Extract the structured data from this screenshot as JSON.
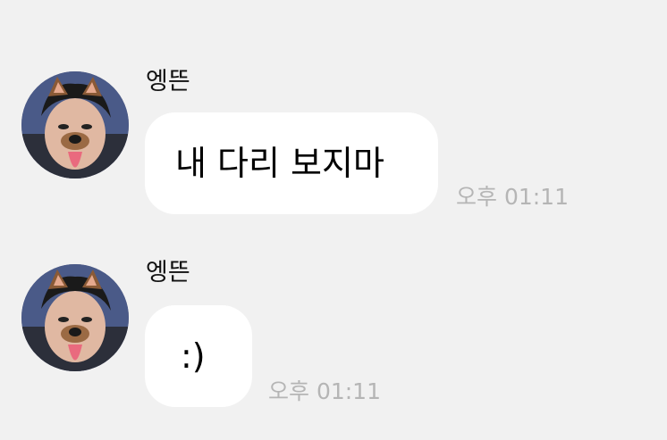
{
  "messages": [
    {
      "sender": "엥뜬",
      "text": "내 다리 보지마",
      "time": "오후 01:11"
    },
    {
      "sender": "엥뜬",
      "text": ":)",
      "time": "오후 01:11"
    }
  ],
  "icons": {
    "avatar": "puppy-filter-avatar"
  },
  "colors": {
    "background": "#f1f1f1",
    "bubble": "#ffffff",
    "timestamp": "#b5b5b5"
  }
}
